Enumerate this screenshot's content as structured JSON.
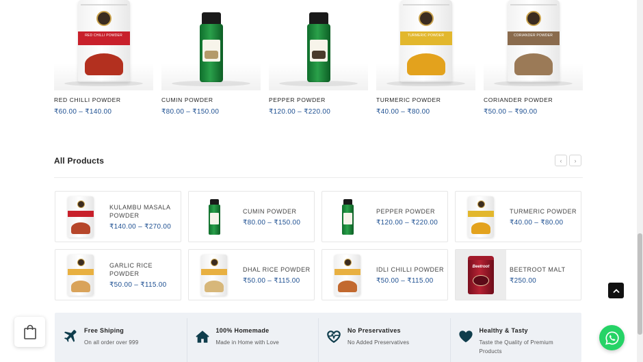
{
  "top_products": [
    {
      "name": "RED CHILLI POWDER",
      "price": "₹60.00 – ₹140.00",
      "pack": "pouch",
      "band_color": "#c8202b",
      "spice_color": "#b3301f",
      "band_text": "RED CHILLI POWDER"
    },
    {
      "name": "CUMIN POWDER",
      "price": "₹80.00 – ₹150.00",
      "pack": "bottle",
      "spice_color": "#b49a6a"
    },
    {
      "name": "PEPPER POWDER",
      "price": "₹120.00 – ₹220.00",
      "pack": "bottle",
      "spice_color": "#4a3b2c"
    },
    {
      "name": "TURMERIC POWDER",
      "price": "₹40.00 – ₹80.00",
      "pack": "pouch",
      "band_color": "#e2b72d",
      "spice_color": "#e3a21d",
      "band_text": "TURMERIC POWDER"
    },
    {
      "name": "CORIANDER POWDER",
      "price": "₹50.00 – ₹90.00",
      "pack": "pouch",
      "band_color": "#8a6b4d",
      "spice_color": "#9b7a57",
      "band_text": "CORIANDER POWDER"
    }
  ],
  "section": {
    "title": "All Products",
    "prev_icon": "chevron-left-icon",
    "next_icon": "chevron-right-icon",
    "prev_glyph": "‹",
    "next_glyph": "›"
  },
  "all_products": [
    {
      "name": "KULAMBU MASALA POWDER",
      "price": "₹140.00 – ₹270.00",
      "pack": "pouch",
      "band_color": "#c8202b",
      "spice_color": "#b6462a"
    },
    {
      "name": "CUMIN POWDER",
      "price": "₹80.00 – ₹150.00",
      "pack": "bottle"
    },
    {
      "name": "PEPPER POWDER",
      "price": "₹120.00 – ₹220.00",
      "pack": "bottle"
    },
    {
      "name": "TURMERIC POWDER",
      "price": "₹40.00 – ₹80.00",
      "pack": "pouch",
      "band_color": "#e2b72d",
      "spice_color": "#e3a21d"
    },
    {
      "name": "GARLIC RICE POWDER",
      "price": "₹50.00 – ₹115.00",
      "pack": "pouch",
      "band_color": "#e8b041",
      "spice_color": "#d9a35a"
    },
    {
      "name": "DHAL RICE POWDER",
      "price": "₹50.00 – ₹115.00",
      "pack": "pouch",
      "band_color": "#e8b041",
      "spice_color": "#d7b77a"
    },
    {
      "name": "IDLI CHILLI POWDER",
      "price": "₹50.00 – ₹115.00",
      "pack": "pouch",
      "band_color": "#e8b041",
      "spice_color": "#c2692f"
    },
    {
      "name": "BEETROOT MALT",
      "price": "₹250.00",
      "pack": "tin",
      "tin_text": "Beetroot"
    }
  ],
  "features": [
    {
      "title": "Free Shiping",
      "subtitle": "On all order over 999",
      "icon": "airplane-icon"
    },
    {
      "title": "100% Homemade",
      "subtitle": "Made in Home with Love",
      "icon": "home-icon"
    },
    {
      "title": "No Preservatives",
      "subtitle": "No Added Preservatives",
      "icon": "heartbeat-icon"
    },
    {
      "title": "Healthy & Tasty",
      "subtitle": "Taste the Quality of Premium Products",
      "icon": "heart-icon"
    }
  ],
  "floating": {
    "cart_icon": "shopping-bag-icon",
    "scroll_top_icon": "chevron-up-icon",
    "whatsapp_icon": "whatsapp-icon"
  },
  "colors": {
    "price": "#1d4f91",
    "feature_icon": "#0f3d4c",
    "whatsapp": "#25d366",
    "feature_bg": "#eef1f5"
  }
}
